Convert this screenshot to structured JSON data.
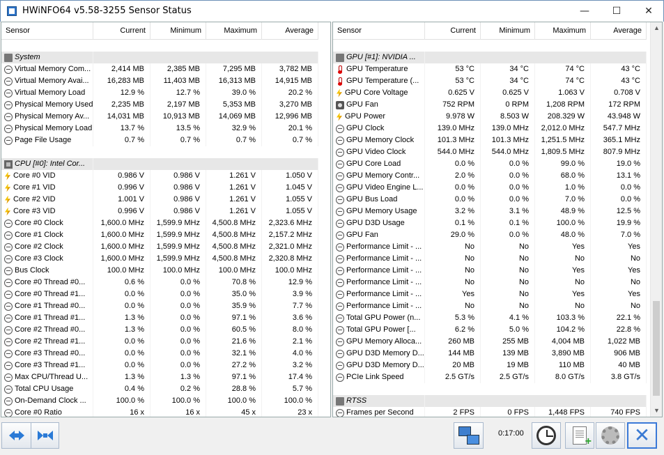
{
  "window": {
    "title": "HWiNFO64 v5.58-3255 Sensor Status",
    "min_glyph": "—",
    "max_glyph": "☐",
    "close_glyph": "✕"
  },
  "columns": {
    "sensor": "Sensor",
    "current": "Current",
    "minimum": "Minimum",
    "maximum": "Maximum",
    "average": "Average"
  },
  "left_rows": [
    {
      "type": "blank"
    },
    {
      "type": "section",
      "icon": "sys",
      "name": "System"
    },
    {
      "icon": "clock",
      "name": "Virtual Memory Com...",
      "cur": "2,414 MB",
      "min": "2,385 MB",
      "max": "7,295 MB",
      "avg": "3,782 MB"
    },
    {
      "icon": "clock",
      "name": "Virtual Memory Avai...",
      "cur": "16,283 MB",
      "min": "11,403 MB",
      "max": "16,313 MB",
      "avg": "14,915 MB"
    },
    {
      "icon": "clock",
      "name": "Virtual Memory Load",
      "cur": "12.9 %",
      "min": "12.7 %",
      "max": "39.0 %",
      "avg": "20.2 %"
    },
    {
      "icon": "clock",
      "name": "Physical Memory Used",
      "cur": "2,235 MB",
      "min": "2,197 MB",
      "max": "5,353 MB",
      "avg": "3,270 MB"
    },
    {
      "icon": "clock",
      "name": "Physical Memory Av...",
      "cur": "14,031 MB",
      "min": "10,913 MB",
      "max": "14,069 MB",
      "avg": "12,996 MB"
    },
    {
      "icon": "clock",
      "name": "Physical Memory Load",
      "cur": "13.7 %",
      "min": "13.5 %",
      "max": "32.9 %",
      "avg": "20.1 %"
    },
    {
      "icon": "clock",
      "name": "Page File Usage",
      "cur": "0.7 %",
      "min": "0.7 %",
      "max": "0.7 %",
      "avg": "0.7 %"
    },
    {
      "type": "blank"
    },
    {
      "type": "section",
      "icon": "cpu",
      "name": "CPU [#0]: Intel Cor..."
    },
    {
      "icon": "bolt",
      "name": "Core #0 VID",
      "cur": "0.986 V",
      "min": "0.986 V",
      "max": "1.261 V",
      "avg": "1.050 V"
    },
    {
      "icon": "bolt",
      "name": "Core #1 VID",
      "cur": "0.996 V",
      "min": "0.986 V",
      "max": "1.261 V",
      "avg": "1.045 V"
    },
    {
      "icon": "bolt",
      "name": "Core #2 VID",
      "cur": "1.001 V",
      "min": "0.986 V",
      "max": "1.261 V",
      "avg": "1.055 V"
    },
    {
      "icon": "bolt",
      "name": "Core #3 VID",
      "cur": "0.996 V",
      "min": "0.986 V",
      "max": "1.261 V",
      "avg": "1.055 V"
    },
    {
      "icon": "clock",
      "name": "Core #0 Clock",
      "cur": "1,600.0 MHz",
      "min": "1,599.9 MHz",
      "max": "4,500.8 MHz",
      "avg": "2,323.6 MHz"
    },
    {
      "icon": "clock",
      "name": "Core #1 Clock",
      "cur": "1,600.0 MHz",
      "min": "1,599.9 MHz",
      "max": "4,500.8 MHz",
      "avg": "2,157.2 MHz"
    },
    {
      "icon": "clock",
      "name": "Core #2 Clock",
      "cur": "1,600.0 MHz",
      "min": "1,599.9 MHz",
      "max": "4,500.8 MHz",
      "avg": "2,321.0 MHz"
    },
    {
      "icon": "clock",
      "name": "Core #3 Clock",
      "cur": "1,600.0 MHz",
      "min": "1,599.9 MHz",
      "max": "4,500.8 MHz",
      "avg": "2,320.8 MHz"
    },
    {
      "icon": "clock",
      "name": "Bus Clock",
      "cur": "100.0 MHz",
      "min": "100.0 MHz",
      "max": "100.0 MHz",
      "avg": "100.0 MHz"
    },
    {
      "icon": "clock",
      "name": "Core #0 Thread #0...",
      "cur": "0.6 %",
      "min": "0.0 %",
      "max": "70.8 %",
      "avg": "12.9 %"
    },
    {
      "icon": "clock",
      "name": "Core #0 Thread #1...",
      "cur": "0.0 %",
      "min": "0.0 %",
      "max": "35.0 %",
      "avg": "3.9 %"
    },
    {
      "icon": "clock",
      "name": "Core #1 Thread #0...",
      "cur": "0.0 %",
      "min": "0.0 %",
      "max": "35.9 %",
      "avg": "7.7 %"
    },
    {
      "icon": "clock",
      "name": "Core #1 Thread #1...",
      "cur": "1.3 %",
      "min": "0.0 %",
      "max": "97.1 %",
      "avg": "3.6 %"
    },
    {
      "icon": "clock",
      "name": "Core #2 Thread #0...",
      "cur": "1.3 %",
      "min": "0.0 %",
      "max": "60.5 %",
      "avg": "8.0 %"
    },
    {
      "icon": "clock",
      "name": "Core #2 Thread #1...",
      "cur": "0.0 %",
      "min": "0.0 %",
      "max": "21.6 %",
      "avg": "2.1 %"
    },
    {
      "icon": "clock",
      "name": "Core #3 Thread #0...",
      "cur": "0.0 %",
      "min": "0.0 %",
      "max": "32.1 %",
      "avg": "4.0 %"
    },
    {
      "icon": "clock",
      "name": "Core #3 Thread #1...",
      "cur": "0.0 %",
      "min": "0.0 %",
      "max": "27.2 %",
      "avg": "3.2 %"
    },
    {
      "icon": "clock",
      "name": "Max CPU/Thread U...",
      "cur": "1.3 %",
      "min": "1.3 %",
      "max": "97.1 %",
      "avg": "17.4 %"
    },
    {
      "icon": "clock",
      "name": "Total CPU Usage",
      "cur": "0.4 %",
      "min": "0.2 %",
      "max": "28.8 %",
      "avg": "5.7 %"
    },
    {
      "icon": "clock",
      "name": "On-Demand Clock ...",
      "cur": "100.0 %",
      "min": "100.0 %",
      "max": "100.0 %",
      "avg": "100.0 %"
    },
    {
      "icon": "clock",
      "name": "Core #0 Ratio",
      "cur": "16 x",
      "min": "16 x",
      "max": "45 x",
      "avg": "23 x"
    }
  ],
  "right_rows": [
    {
      "type": "blank"
    },
    {
      "type": "section",
      "icon": "sys",
      "name": "GPU [#1]: NVIDIA ..."
    },
    {
      "icon": "therm",
      "name": "GPU Temperature",
      "cur": "53 °C",
      "min": "34 °C",
      "max": "74 °C",
      "avg": "43 °C"
    },
    {
      "icon": "therm",
      "name": "GPU Temperature (...",
      "cur": "53 °C",
      "min": "34 °C",
      "max": "74 °C",
      "avg": "43 °C"
    },
    {
      "icon": "bolt",
      "name": "GPU Core Voltage",
      "cur": "0.625 V",
      "min": "0.625 V",
      "max": "1.063 V",
      "avg": "0.708 V"
    },
    {
      "icon": "fan",
      "name": "GPU Fan",
      "cur": "752 RPM",
      "min": "0 RPM",
      "max": "1,208 RPM",
      "avg": "172 RPM"
    },
    {
      "icon": "bolt",
      "name": "GPU Power",
      "cur": "9.978 W",
      "min": "8.503 W",
      "max": "208.329 W",
      "avg": "43.948 W"
    },
    {
      "icon": "clock",
      "name": "GPU Clock",
      "cur": "139.0 MHz",
      "min": "139.0 MHz",
      "max": "2,012.0 MHz",
      "avg": "547.7 MHz"
    },
    {
      "icon": "clock",
      "name": "GPU Memory Clock",
      "cur": "101.3 MHz",
      "min": "101.3 MHz",
      "max": "1,251.5 MHz",
      "avg": "365.1 MHz"
    },
    {
      "icon": "clock",
      "name": "GPU Video Clock",
      "cur": "544.0 MHz",
      "min": "544.0 MHz",
      "max": "1,809.5 MHz",
      "avg": "807.9 MHz"
    },
    {
      "icon": "clock",
      "name": "GPU Core Load",
      "cur": "0.0 %",
      "min": "0.0 %",
      "max": "99.0 %",
      "avg": "19.0 %"
    },
    {
      "icon": "clock",
      "name": "GPU Memory Contr...",
      "cur": "2.0 %",
      "min": "0.0 %",
      "max": "68.0 %",
      "avg": "13.1 %"
    },
    {
      "icon": "clock",
      "name": "GPU Video Engine L...",
      "cur": "0.0 %",
      "min": "0.0 %",
      "max": "1.0 %",
      "avg": "0.0 %"
    },
    {
      "icon": "clock",
      "name": "GPU Bus Load",
      "cur": "0.0 %",
      "min": "0.0 %",
      "max": "7.0 %",
      "avg": "0.0 %"
    },
    {
      "icon": "clock",
      "name": "GPU Memory Usage",
      "cur": "3.2 %",
      "min": "3.1 %",
      "max": "48.9 %",
      "avg": "12.5 %"
    },
    {
      "icon": "clock",
      "name": "GPU D3D Usage",
      "cur": "0.1 %",
      "min": "0.1 %",
      "max": "100.0 %",
      "avg": "19.9 %"
    },
    {
      "icon": "clock",
      "name": "GPU Fan",
      "cur": "29.0 %",
      "min": "0.0 %",
      "max": "48.0 %",
      "avg": "7.0 %"
    },
    {
      "icon": "clock",
      "name": "Performance Limit - ...",
      "cur": "No",
      "min": "No",
      "max": "Yes",
      "avg": "Yes"
    },
    {
      "icon": "clock",
      "name": "Performance Limit - ...",
      "cur": "No",
      "min": "No",
      "max": "No",
      "avg": "No"
    },
    {
      "icon": "clock",
      "name": "Performance Limit - ...",
      "cur": "No",
      "min": "No",
      "max": "Yes",
      "avg": "Yes"
    },
    {
      "icon": "clock",
      "name": "Performance Limit - ...",
      "cur": "No",
      "min": "No",
      "max": "No",
      "avg": "No"
    },
    {
      "icon": "clock",
      "name": "Performance Limit - ...",
      "cur": "Yes",
      "min": "No",
      "max": "Yes",
      "avg": "Yes"
    },
    {
      "icon": "clock",
      "name": "Performance Limit - ...",
      "cur": "No",
      "min": "No",
      "max": "No",
      "avg": "No"
    },
    {
      "icon": "clock",
      "name": "Total GPU Power (n...",
      "cur": "5.3 %",
      "min": "4.1 %",
      "max": "103.3 %",
      "avg": "22.1 %"
    },
    {
      "icon": "clock",
      "name": "Total GPU Power [...",
      "cur": "6.2 %",
      "min": "5.0 %",
      "max": "104.2 %",
      "avg": "22.8 %"
    },
    {
      "icon": "clock",
      "name": "GPU Memory Alloca...",
      "cur": "260 MB",
      "min": "255 MB",
      "max": "4,004 MB",
      "avg": "1,022 MB"
    },
    {
      "icon": "clock",
      "name": "GPU D3D Memory D...",
      "cur": "144 MB",
      "min": "139 MB",
      "max": "3,890 MB",
      "avg": "906 MB"
    },
    {
      "icon": "clock",
      "name": "GPU D3D Memory D...",
      "cur": "20 MB",
      "min": "19 MB",
      "max": "110 MB",
      "avg": "40 MB"
    },
    {
      "icon": "clock",
      "name": "PCIe Link Speed",
      "cur": "2.5 GT/s",
      "min": "2.5 GT/s",
      "max": "8.0 GT/s",
      "avg": "3.8 GT/s"
    },
    {
      "type": "blank"
    },
    {
      "type": "section",
      "icon": "sys",
      "name": "RTSS"
    },
    {
      "icon": "clock",
      "name": "Frames per Second",
      "cur": "2 FPS",
      "min": "0 FPS",
      "max": "1,448 FPS",
      "avg": "740 FPS"
    }
  ],
  "scrollbar": {
    "up_glyph": "▲",
    "down_glyph": "▼"
  },
  "toolbar": {
    "elapsed": "0:17:00"
  }
}
